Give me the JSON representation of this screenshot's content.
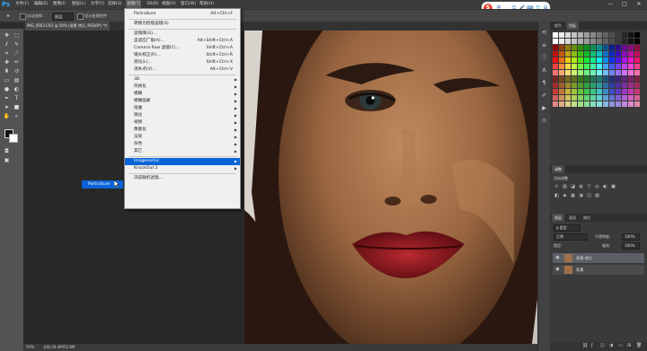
{
  "app": {
    "logo": "Ps"
  },
  "menubar": {
    "items": [
      "文件(F)",
      "编辑(E)",
      "图像(I)",
      "图层(L)",
      "文字(Y)",
      "选择(S)",
      "滤镜(T)",
      "3D(D)",
      "视图(V)",
      "窗口(W)",
      "帮助(H)"
    ],
    "active_index": 6
  },
  "options": {
    "auto_select": "自动选择：",
    "group_value": "图层",
    "show_transform": "显示变换控件"
  },
  "ime": {
    "logo": "S",
    "mode": "中",
    "icons": [
      "·",
      "☺",
      "🎤",
      "⌨",
      "👕",
      "⊞"
    ]
  },
  "window_controls": [
    "—",
    "□",
    "✕"
  ],
  "document": {
    "tab": "IMG_0903.CR2 @ 50% (背景 拷贝, RGB/8*) *",
    "close": "×"
  },
  "status": {
    "zoom": "50%",
    "doc": "文档:26.4M/52.8M"
  },
  "filter_menu": {
    "items": [
      {
        "label": "Portraiture",
        "shortcut": "Alt+Ctrl+F"
      },
      {
        "sep": true
      },
      {
        "label": "转换为智能滤镜(S)"
      },
      {
        "sep": true
      },
      {
        "label": "滤镜库(G)..."
      },
      {
        "label": "自适应广角(A)...",
        "shortcut": "Alt+Shift+Ctrl+A"
      },
      {
        "label": "Camera Raw 滤镜(C)...",
        "shortcut": "Shift+Ctrl+A"
      },
      {
        "label": "镜头校正(R)...",
        "shortcut": "Shift+Ctrl+R"
      },
      {
        "label": "液化(L)...",
        "shortcut": "Shift+Ctrl+X"
      },
      {
        "label": "消失点(V)...",
        "shortcut": "Alt+Ctrl+V"
      },
      {
        "sep": true
      },
      {
        "label": "3D",
        "sub": true
      },
      {
        "label": "风格化",
        "sub": true
      },
      {
        "label": "模糊",
        "sub": true
      },
      {
        "label": "模糊画廊",
        "sub": true
      },
      {
        "label": "扭曲",
        "sub": true
      },
      {
        "label": "锐化",
        "sub": true
      },
      {
        "label": "视频",
        "sub": true
      },
      {
        "label": "像素化",
        "sub": true
      },
      {
        "label": "渲染",
        "sub": true
      },
      {
        "label": "杂色",
        "sub": true
      },
      {
        "label": "其它",
        "sub": true
      },
      {
        "sep": true
      },
      {
        "label": "Imagenomic",
        "sub": true,
        "highlight": true
      },
      {
        "label": "KnockOut 2",
        "sub": true
      },
      {
        "sep": true
      },
      {
        "label": "浏览联机滤镜..."
      }
    ]
  },
  "submenu": {
    "label": "Portraiture"
  },
  "panels": {
    "color_tabs": [
      "颜色",
      "色板"
    ],
    "adjust_tab": "调整",
    "adjust_label": "添加调整",
    "layers_tabs": [
      "图层",
      "通道",
      "路径"
    ],
    "kind": "ρ 类型",
    "blend": "正常",
    "opacity_label": "不透明度:",
    "opacity": "100%",
    "lock_label": "锁定:",
    "fill_label": "填充:",
    "fill": "100%",
    "layers": [
      {
        "name": "背景 拷贝",
        "selected": true
      },
      {
        "name": "背景",
        "selected": false
      }
    ]
  },
  "colors": {
    "menu_highlight": "#0a64d7",
    "ps_blue": "#31a8ff"
  }
}
